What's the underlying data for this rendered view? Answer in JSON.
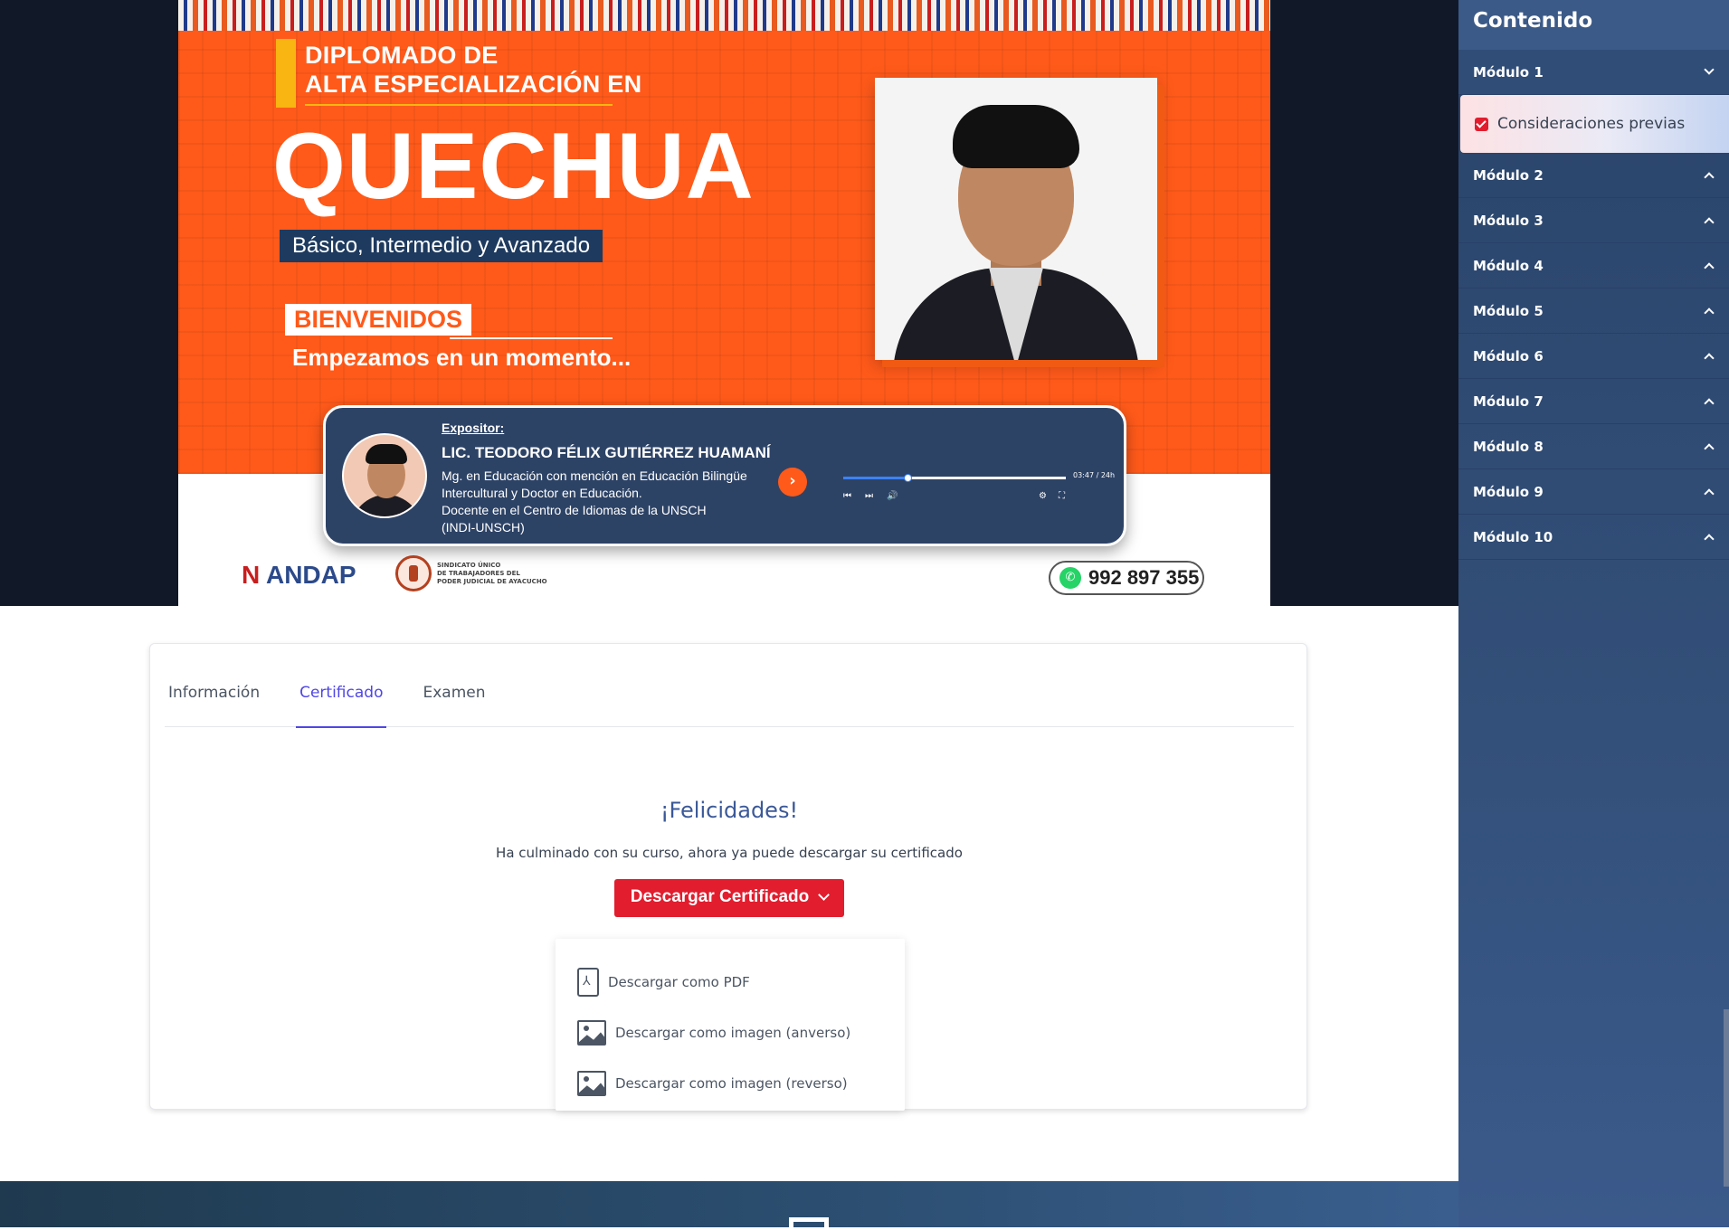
{
  "banner": {
    "title_line1": "DIPLOMADO DE",
    "title_line2": "ALTA ESPECIALIZACIÓN EN",
    "course": "QUECHUA",
    "levels": "Básico, Intermedio y Avanzado",
    "welcome": "BIENVENIDOS",
    "starting": "Empezamos en un momento...",
    "speaker_label": "Expositor:",
    "speaker_name": "LIC. TEODORO FÉLIX GUTIÉRREZ HUAMANÍ",
    "speaker_desc": [
      "Mg. en Educación con mención en Educación Bilingüe",
      "Intercultural y Doctor en Educación.",
      "Docente en el Centro de Idiomas de la UNSCH",
      "(INDI-UNSCH)"
    ],
    "player_time": "03:47 / 24h",
    "player_progress": 0.29,
    "logo_andap": "ANDAP",
    "logo_sindicato": [
      "SINDICATO ÚNICO",
      "DE TRABAJADORES DEL",
      "PODER JUDICIAL DE AYACUCHO"
    ],
    "phone": "992 897 355"
  },
  "tabs": [
    {
      "label": "Información",
      "active": false
    },
    {
      "label": "Certificado",
      "active": true
    },
    {
      "label": "Examen",
      "active": false
    }
  ],
  "certificate": {
    "title": "¡Felicidades!",
    "message": "Ha culminado con su curso, ahora ya puede descargar su certificado",
    "button": "Descargar Certificado",
    "options": [
      {
        "label": "Descargar como PDF",
        "icon": "pdf-icon"
      },
      {
        "label": "Descargar como imagen (anverso)",
        "icon": "image-icon"
      },
      {
        "label": "Descargar como imagen (reverso)",
        "icon": "image-icon"
      }
    ]
  },
  "sidebar": {
    "title": "Contenido",
    "modules": [
      {
        "label": "Módulo 1",
        "open": true,
        "lessons": [
          {
            "label": "Consideraciones previas",
            "completed": true
          }
        ]
      },
      {
        "label": "Módulo 2",
        "open": false
      },
      {
        "label": "Módulo 3",
        "open": false
      },
      {
        "label": "Módulo 4",
        "open": false
      },
      {
        "label": "Módulo 5",
        "open": false
      },
      {
        "label": "Módulo 6",
        "open": false
      },
      {
        "label": "Módulo 7",
        "open": false
      },
      {
        "label": "Módulo 8",
        "open": false
      },
      {
        "label": "Módulo 9",
        "open": false
      },
      {
        "label": "Módulo 10",
        "open": false
      }
    ]
  },
  "colors": {
    "accent_red": "#e11d2e",
    "tab_active": "#4f46e5",
    "banner_orange": "#ff5a1a",
    "sidebar_bg": "#2a446a"
  }
}
